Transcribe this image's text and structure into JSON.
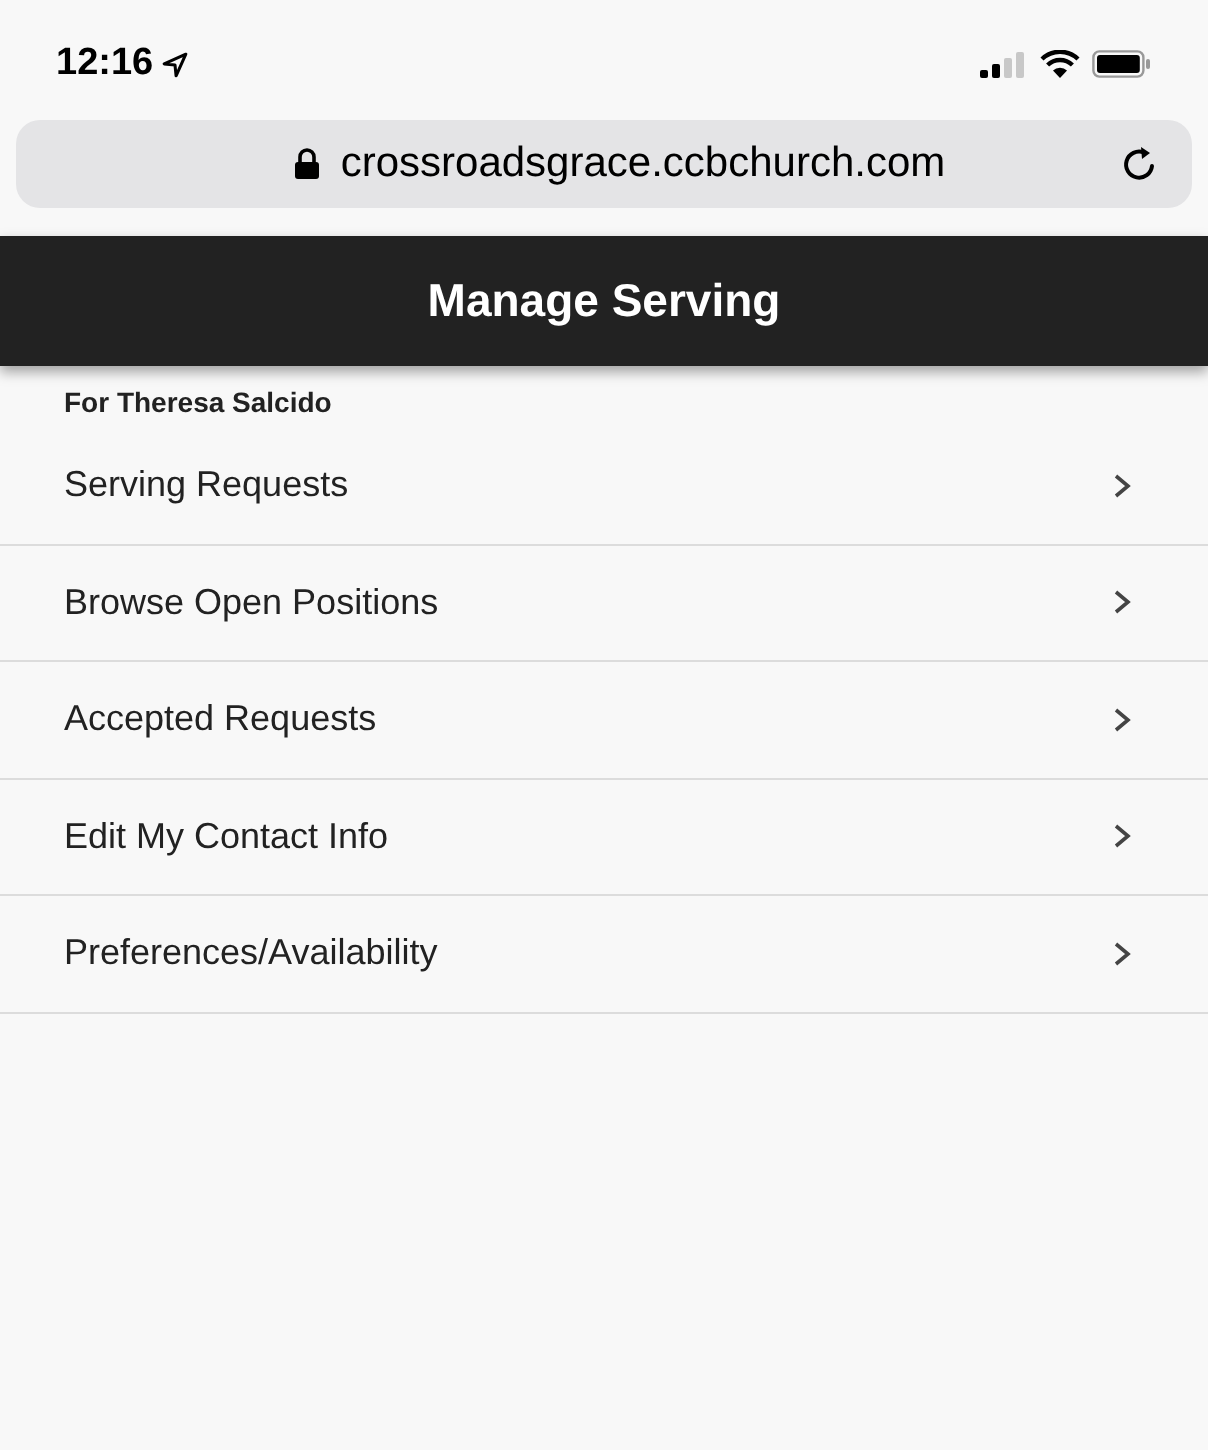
{
  "status_bar": {
    "time": "12:16"
  },
  "address_bar": {
    "url": "crossroadsgrace.ccbchurch.com"
  },
  "header": {
    "title": "Manage Serving"
  },
  "subtitle": "For Theresa Salcido",
  "menu_items": [
    {
      "label": "Serving Requests"
    },
    {
      "label": "Browse Open Positions"
    },
    {
      "label": "Accepted Requests"
    },
    {
      "label": "Edit My Contact Info"
    },
    {
      "label": "Preferences/Availability"
    }
  ]
}
